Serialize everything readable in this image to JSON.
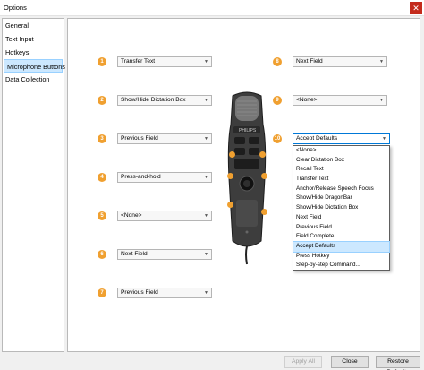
{
  "window": {
    "title": "Options",
    "close_glyph": "✕"
  },
  "sidebar": {
    "items": [
      {
        "label": "General"
      },
      {
        "label": "Text Input"
      },
      {
        "label": "Hotkeys"
      },
      {
        "label": "Microphone Buttons"
      },
      {
        "label": "Data Collection"
      }
    ],
    "active": "Microphone Buttons"
  },
  "buttons": [
    {
      "number": "1",
      "value": "Transfer Text"
    },
    {
      "number": "2",
      "value": "Show/Hide Dictation Box"
    },
    {
      "number": "3",
      "value": "Previous Field"
    },
    {
      "number": "4",
      "value": "Press-and-hold"
    },
    {
      "number": "5",
      "value": "<None>"
    },
    {
      "number": "6",
      "value": "Next Field"
    },
    {
      "number": "7",
      "value": "Previous Field"
    },
    {
      "number": "8",
      "value": "Next Field"
    },
    {
      "number": "9",
      "value": "<None>"
    },
    {
      "number": "10",
      "value": "Accept Defaults"
    }
  ],
  "dropdown": {
    "options": [
      "<None>",
      "Clear Dictation Box",
      "Recall Text",
      "Transfer Text",
      "Anchor/Release Speech Focus",
      "Show/Hide DragonBar",
      "Show/Hide Dictation Box",
      "Next Field",
      "Previous Field",
      "Field Complete",
      "Accept Defaults",
      "Press Hotkey",
      "Step-by-step Command..."
    ],
    "selected": "Accept Defaults"
  },
  "device": {
    "brand": "PHILIPS"
  },
  "footer": {
    "apply_all": "Apply All",
    "close": "Close",
    "restore_defaults": "Restore Defaults"
  },
  "colors": {
    "badge": "#f0a030",
    "selection": "#cce8ff",
    "close_button": "#c42b1c"
  }
}
